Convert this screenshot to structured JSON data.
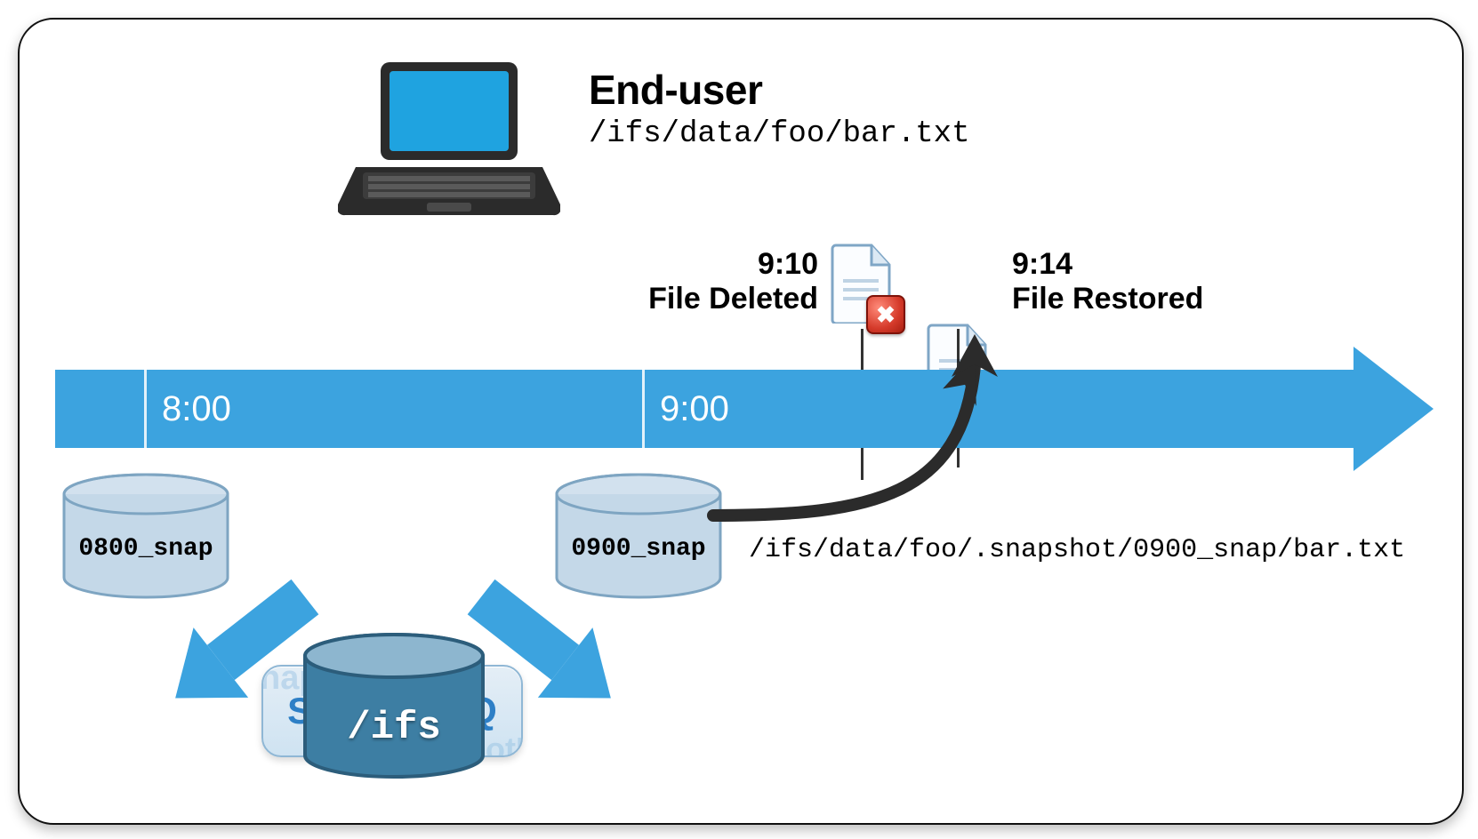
{
  "end_user": {
    "title": "End-user",
    "path": "/ifs/data/foo/bar.txt"
  },
  "events": {
    "deleted": {
      "time": "9:10",
      "label": "File Deleted"
    },
    "restored": {
      "time": "9:14",
      "label": "File Restored"
    }
  },
  "timeline": {
    "t1": "8:00",
    "t2": "9:00"
  },
  "snapshots": {
    "left": "0800_snap",
    "right": "0900_snap",
    "product": "SnapshotIQ",
    "source": "/ifs",
    "restore_path": "/ifs/data/foo/.snapshot/0900_snap/bar.txt"
  },
  "colors": {
    "accent": "#3ca3df",
    "dbLight": "#c7d9e6",
    "dbDark": "#2f6f94"
  }
}
